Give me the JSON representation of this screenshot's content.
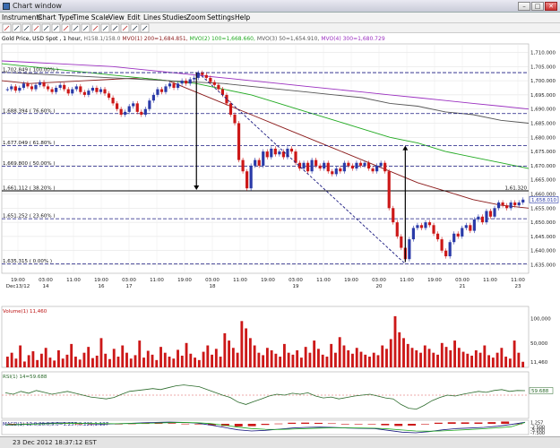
{
  "window": {
    "title": "Chart window",
    "controls": [
      "–",
      "□",
      "✕"
    ]
  },
  "menu": [
    "Instruments",
    "Chart Type",
    "Time Scale",
    "View",
    "Edit",
    "Lines",
    "Studies",
    "Zoom",
    "Settings",
    "Help"
  ],
  "toolbar_icons": [
    "arrow-icon",
    "crosshair-icon",
    "line-icon",
    "ray-icon",
    "channel-icon",
    "fibonacci-icon",
    "rectangle-icon",
    "ellipse-icon",
    "text-icon",
    "zoom-in-icon",
    "zoom-out-icon",
    "scroll-icon",
    "grid-icon",
    "print-icon",
    "properties-icon"
  ],
  "legend": {
    "instrument": "Gold Price, USD Spot , 1 hour, ",
    "ohlc": "H158.1/158.0",
    "mvo200": "MVO(1) 200=1,684.851,",
    "mvo100": "MVO(2) 100=1,668.660,",
    "mvo50": "MVO(3) 50=1,654.910,",
    "mvo300": "MVO(4) 300=1,680.729"
  },
  "colors": {
    "up": "#2a3aa8",
    "down": "#cc1818",
    "ma1": "#8b1a1a",
    "ma2": "#22aa22",
    "ma3": "#9b30c0",
    "ma4": "#555555",
    "fib": "#1a1a80",
    "grid": "#dddddd"
  },
  "fib_levels": [
    {
      "label": "1,702.849 ( 100.00% )",
      "value": 1702.849
    },
    {
      "label": "1,688.394 ( 76.60% )",
      "value": 1688.394
    },
    {
      "label": "1,677.049 ( 61.80% )",
      "value": 1677.049
    },
    {
      "label": "1,669.800 ( 50.00% )",
      "value": 1669.8
    },
    {
      "label": "1,661.112 ( 38.20% )",
      "value": 1661.112
    },
    {
      "label": "1,651.252 ( 23.60% )",
      "value": 1651.252
    },
    {
      "label": "1,635.315 ( 0.00% )",
      "value": 1635.315
    }
  ],
  "price_marks": {
    "current": "1,658.010",
    "level_1661": "1,61.320"
  },
  "chart_data": [
    {
      "type": "candlestick",
      "title": "Gold Price, USD Spot , 1 hour",
      "y_ticks": [
        "1,710.000",
        "1,705.000",
        "1,700.000",
        "1,695.000",
        "1,690.000",
        "1,685.000",
        "1,680.000",
        "1,675.000",
        "1,670.000",
        "1,665.000",
        "1,660.000",
        "1,655.000",
        "1,650.000",
        "1,645.000",
        "1,640.000",
        "1,635.000"
      ],
      "y_values": [
        1710,
        1705,
        1700,
        1695,
        1690,
        1685,
        1680,
        1675,
        1670,
        1665,
        1660,
        1655,
        1650,
        1645,
        1640,
        1635
      ],
      "ylim": [
        1632,
        1713
      ],
      "x_labels": [
        {
          "time": "19:00",
          "date": "Dec13/12"
        },
        {
          "time": "03:00",
          "date": "14"
        },
        {
          "time": "11:00",
          "date": ""
        },
        {
          "time": "19:00",
          "date": "16"
        },
        {
          "time": "03:00",
          "date": "17"
        },
        {
          "time": "11:00",
          "date": ""
        },
        {
          "time": "19:00",
          "date": ""
        },
        {
          "time": "03:00",
          "date": "18"
        },
        {
          "time": "11:00",
          "date": ""
        },
        {
          "time": "19:00",
          "date": ""
        },
        {
          "time": "03:00",
          "date": "19"
        },
        {
          "time": "11:00",
          "date": ""
        },
        {
          "time": "19:00",
          "date": ""
        },
        {
          "time": "03:00",
          "date": "20"
        },
        {
          "time": "11:00",
          "date": ""
        },
        {
          "time": "19:00",
          "date": ""
        },
        {
          "time": "03:00",
          "date": "21"
        },
        {
          "time": "11:00",
          "date": ""
        },
        {
          "time": "11:00",
          "date": "23"
        }
      ],
      "close": [
        1697,
        1698,
        1696.5,
        1697.5,
        1699,
        1698,
        1697,
        1698.5,
        1699.5,
        1698,
        1697,
        1696,
        1697.5,
        1698.5,
        1697,
        1695.5,
        1697,
        1698,
        1696,
        1695,
        1696.5,
        1697.5,
        1696,
        1697,
        1695.5,
        1694,
        1692,
        1690,
        1688,
        1689,
        1691,
        1692,
        1689,
        1688,
        1690,
        1693,
        1695,
        1697,
        1696,
        1698,
        1699,
        1697.5,
        1699,
        1700,
        1699,
        1700.5,
        1701,
        1702.8,
        1702,
        1701,
        1699.5,
        1698.5,
        1697,
        1695,
        1692,
        1688,
        1685,
        1672,
        1668,
        1662,
        1670,
        1672,
        1670,
        1675,
        1673,
        1676,
        1674,
        1675,
        1673,
        1676,
        1675,
        1671,
        1669,
        1671,
        1668,
        1672,
        1670,
        1669,
        1671,
        1668,
        1667,
        1669,
        1668,
        1671,
        1670,
        1669,
        1671,
        1670,
        1671,
        1669,
        1668,
        1670,
        1671,
        1668,
        1655,
        1650,
        1645,
        1641,
        1637,
        1644,
        1648,
        1649,
        1648,
        1650,
        1649,
        1646,
        1644,
        1640,
        1638,
        1643,
        1646,
        1645,
        1648,
        1649,
        1647,
        1651,
        1652,
        1650,
        1654,
        1652,
        1655,
        1657,
        1656,
        1655,
        1657,
        1656,
        1657,
        1658.01
      ],
      "ma_slow": [
        1705,
        1688
      ],
      "series": [
        {
          "name": "MVO(1) 200",
          "values": [
            1700,
            1699,
            1699.5,
            1700,
            1700.5,
            1701,
            1700,
            1696,
            1692,
            1688,
            1684,
            1680,
            1676,
            1672,
            1668,
            1664,
            1661,
            1658,
            1656,
            1655
          ]
        },
        {
          "name": "MVO(2) 100",
          "values": [
            1706,
            1705,
            1704,
            1703,
            1702,
            1701,
            1700,
            1699,
            1697,
            1695,
            1692,
            1689,
            1686,
            1683,
            1680,
            1678,
            1675,
            1673,
            1671,
            1669
          ]
        },
        {
          "name": "MVO(3) 50",
          "values": [
            1707,
            1706.5,
            1706,
            1705.5,
            1705,
            1704,
            1703,
            1702,
            1701,
            1700,
            1699,
            1698,
            1697,
            1696,
            1695,
            1694,
            1693,
            1692,
            1691,
            1690
          ]
        },
        {
          "name": "MVO(4) 300",
          "values": [
            1703,
            1702.5,
            1702,
            1701.5,
            1701,
            1700.5,
            1700,
            1699.5,
            1699,
            1698,
            1697,
            1696,
            1695,
            1694,
            1692,
            1691,
            1689,
            1688,
            1686,
            1685
          ]
        }
      ]
    },
    {
      "type": "bar",
      "title": "Volume(1) 11,460",
      "y_ticks": [
        "100,000",
        "50,000",
        "11,460"
      ],
      "y_values": [
        100000,
        50000,
        11460
      ],
      "ylim": [
        0,
        125000
      ],
      "values": [
        22000,
        30000,
        18000,
        45000,
        12000,
        25000,
        33000,
        15000,
        28000,
        40000,
        20000,
        14000,
        35000,
        18000,
        26000,
        48000,
        22000,
        16000,
        30000,
        42000,
        19000,
        24000,
        60000,
        28000,
        17000,
        38000,
        22000,
        45000,
        30000,
        18000,
        25000,
        55000,
        20000,
        34000,
        26000,
        15000,
        42000,
        30000,
        22000,
        18000,
        36000,
        24000,
        50000,
        28000,
        20000,
        15000,
        32000,
        45000,
        26000,
        38000,
        22000,
        70000,
        55000,
        40000,
        30000,
        95000,
        80000,
        60000,
        45000,
        30000,
        25000,
        40000,
        35000,
        28000,
        22000,
        48000,
        30000,
        26000,
        35000,
        20000,
        42000,
        30000,
        55000,
        38000,
        26000,
        22000,
        48000,
        30000,
        62000,
        45000,
        35000,
        28000,
        40000,
        32000,
        26000,
        22000,
        30000,
        25000,
        45000,
        38000,
        58000,
        105000,
        72000,
        60000,
        48000,
        40000,
        35000,
        30000,
        45000,
        38000,
        30000,
        26000,
        50000,
        42000,
        35000,
        55000,
        40000,
        32000,
        28000,
        24000,
        35000,
        30000,
        45000,
        25000,
        20000,
        30000,
        40000,
        22000,
        18000,
        55000,
        30000,
        11460
      ],
      "colors": {
        "bar": "#cc1818"
      }
    },
    {
      "type": "line",
      "title": "RSI(1) 14=59.688",
      "y_ticks": [
        "59.688"
      ],
      "y_values": [
        59.688
      ],
      "ylim": [
        0,
        100
      ],
      "reference_line": 50,
      "values": [
        55,
        52,
        58,
        54,
        60,
        56,
        52,
        55,
        58,
        54,
        50,
        46,
        44,
        42,
        45,
        52,
        58,
        60,
        62,
        64,
        62,
        66,
        70,
        72,
        70,
        68,
        62,
        56,
        50,
        45,
        35,
        30,
        36,
        42,
        48,
        52,
        50,
        54,
        52,
        55,
        48,
        44,
        46,
        42,
        45,
        48,
        50,
        52,
        48,
        44,
        42,
        30,
        22,
        20,
        28,
        38,
        45,
        50,
        48,
        52,
        55,
        58,
        56,
        60,
        62,
        58,
        60,
        59.688
      ]
    },
    {
      "type": "line",
      "title": "MACD(1) 12.0,26.0,9.0=1.257,0.221,1.137",
      "y_ticks": [
        "1.257",
        "-2.500",
        "-5.000",
        "-7.500"
      ],
      "y_values": [
        1.257,
        -2.5,
        -5,
        -7.5
      ],
      "ylim": [
        -9,
        3
      ],
      "series": [
        {
          "name": "MACD",
          "values": [
            -1,
            -0.5,
            0,
            0.5,
            0.8,
            0.6,
            0.2,
            -0.2,
            0,
            0.4,
            0.8,
            1.2,
            1.5,
            1.2,
            0.6,
            -1,
            -3,
            -5,
            -6,
            -5.5,
            -4.5,
            -3.5,
            -3,
            -2.8,
            -3,
            -3.5,
            -3.8,
            -4,
            -5.5,
            -7,
            -7.5,
            -6.5,
            -5,
            -4,
            -3.5,
            -3,
            -2,
            -0.5,
            1.257
          ]
        },
        {
          "name": "Signal",
          "values": [
            -0.8,
            -0.6,
            -0.3,
            0,
            0.3,
            0.5,
            0.4,
            0.2,
            0.1,
            0.2,
            0.4,
            0.7,
            1,
            1.1,
            0.9,
            0.2,
            -1.2,
            -2.8,
            -4,
            -4.6,
            -4.7,
            -4.4,
            -4,
            -3.6,
            -3.4,
            -3.4,
            -3.5,
            -3.7,
            -4.3,
            -5.2,
            -6,
            -6.2,
            -5.9,
            -5.3,
            -4.7,
            -4.1,
            -3.4,
            -2.4,
            1.137
          ]
        }
      ],
      "histogram_label": "0.221"
    }
  ],
  "status": {
    "text": "23 Dec 2012 18:37:12 EST"
  }
}
